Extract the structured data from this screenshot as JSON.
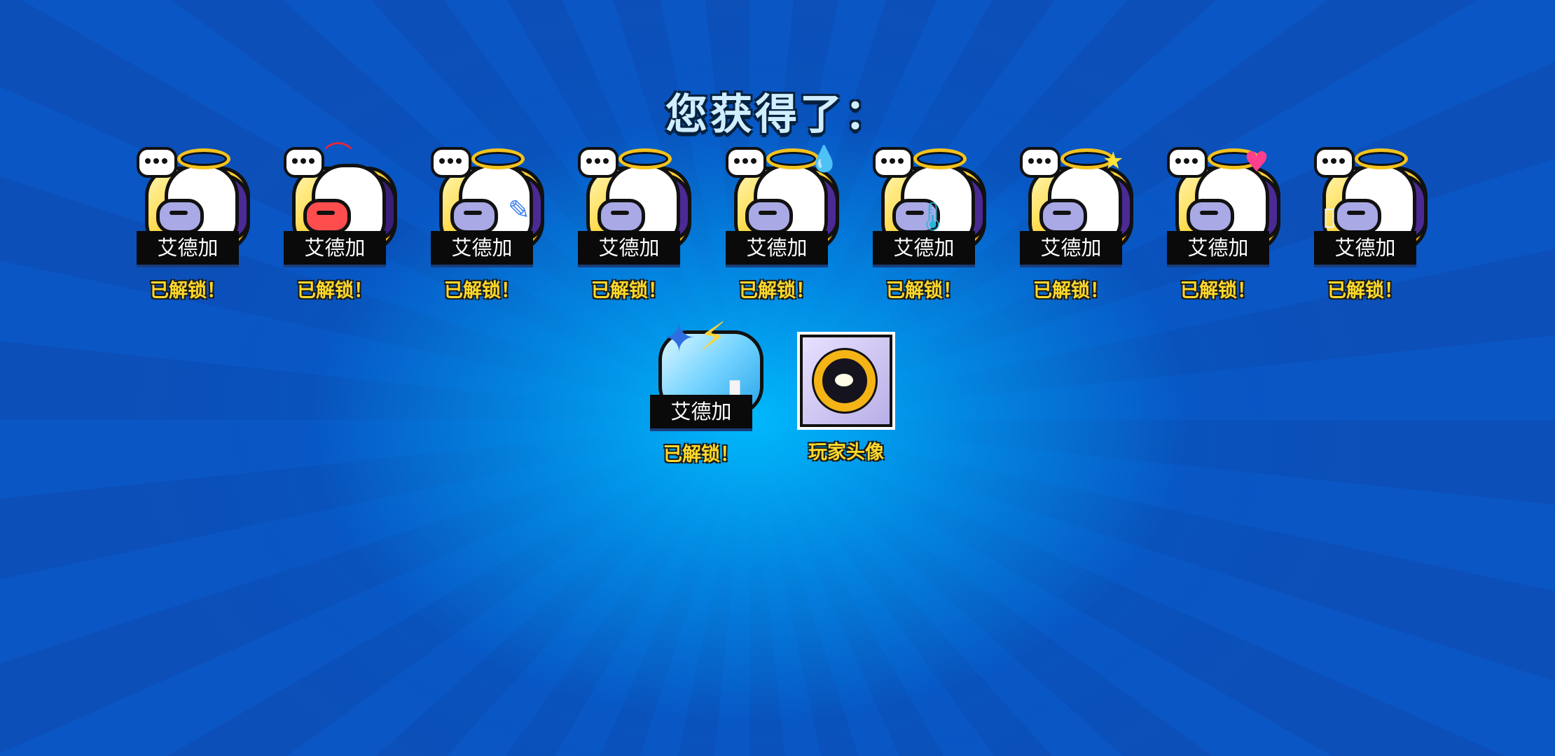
{
  "header": {
    "title": "您获得了："
  },
  "pins": [
    {
      "name": "艾德加",
      "status": "已解锁！",
      "icon": "edgar-pin-halo-neutral-icon"
    },
    {
      "name": "艾德加",
      "status": "已解锁！",
      "icon": "edgar-pin-devil-angry-icon"
    },
    {
      "name": "艾德加",
      "status": "已解锁！",
      "icon": "edgar-pin-broken-heart-icon"
    },
    {
      "name": "艾德加",
      "status": "已解锁！",
      "icon": "edgar-pin-halo-smile-icon"
    },
    {
      "name": "艾德加",
      "status": "已解锁！",
      "icon": "edgar-pin-sweat-drop-icon"
    },
    {
      "name": "艾德加",
      "status": "已解锁！",
      "icon": "edgar-pin-thermometer-icon"
    },
    {
      "name": "艾德加",
      "status": "已解锁！",
      "icon": "edgar-pin-star-icon"
    },
    {
      "name": "艾德加",
      "status": "已解锁！",
      "icon": "edgar-pin-heart-icon"
    },
    {
      "name": "艾德加",
      "status": "已解锁！",
      "icon": "edgar-pin-phone-icon"
    },
    {
      "name": "艾德加",
      "status": "已解锁！",
      "icon": "edgar-pin-spray-paint-icon"
    }
  ],
  "avatar": {
    "label": "玩家头像",
    "icon": "golden-eye-avatar-icon"
  },
  "colors": {
    "status_yellow": "#ffd92a",
    "title": "#cfeeff",
    "pin_gold": "#ffd53a",
    "purple": "#4b2a95"
  }
}
